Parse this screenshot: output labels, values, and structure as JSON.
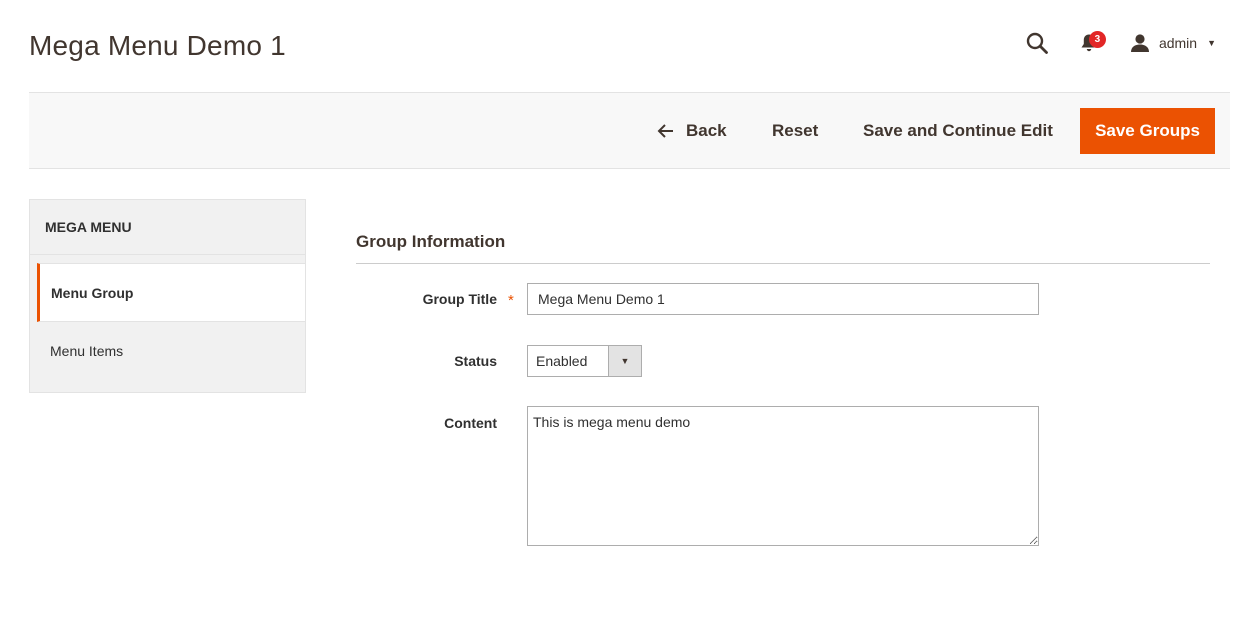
{
  "page": {
    "title": "Mega Menu Demo 1"
  },
  "header": {
    "search_icon": "search-icon",
    "notifications": {
      "icon": "bell-icon",
      "count": "3",
      "badge_color": "#e22626"
    },
    "user": {
      "icon": "user-icon",
      "name": "admin"
    }
  },
  "actions": {
    "back_label": "Back",
    "reset_label": "Reset",
    "save_continue_label": "Save and Continue Edit",
    "save_label": "Save Groups",
    "accent_color": "#eb5202"
  },
  "sidebar": {
    "title": "MEGA MENU",
    "items": [
      {
        "label": "Menu Group",
        "active": true
      },
      {
        "label": "Menu Items",
        "active": false
      }
    ]
  },
  "form": {
    "section_title": "Group Information",
    "group_title": {
      "label": "Group Title",
      "required_mark": "*",
      "value": "Mega Menu Demo 1"
    },
    "status": {
      "label": "Status",
      "value": "Enabled"
    },
    "content": {
      "label": "Content",
      "value": "This is mega menu demo"
    }
  }
}
